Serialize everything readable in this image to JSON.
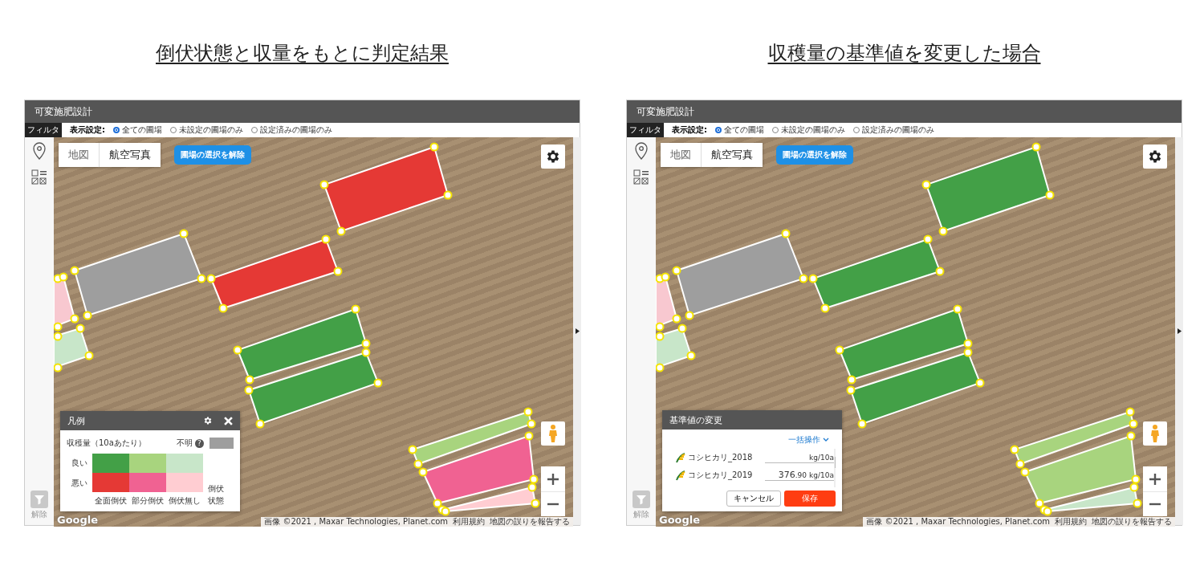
{
  "panels": [
    {
      "heading": "倒伏状態と収量をもとに判定結果",
      "app_title": "可変施肥設計",
      "filter_tab": "フィルタ",
      "display_label": "表示設定:",
      "display_options": [
        {
          "label": "全ての圃場",
          "selected": true
        },
        {
          "label": "未設定の圃場のみ",
          "selected": false
        },
        {
          "label": "設定済みの圃場のみ",
          "selected": false
        }
      ],
      "map_types": [
        {
          "label": "地図",
          "selected": false
        },
        {
          "label": "航空写真",
          "selected": true
        }
      ],
      "clear_button": "圃場の選択を解除",
      "filter_clear": "解除",
      "logo": "Google",
      "attribution": [
        "画像 ©2021 , Maxar Technologies, Planet.com",
        "利用規約",
        "地図の誤りを報告する"
      ],
      "fields": [
        {
          "color": "#e53935"
        },
        {
          "color": "#9e9e9e"
        },
        {
          "color": "#e53935"
        },
        {
          "color": "#43a047"
        },
        {
          "color": "#43a047"
        },
        {
          "color": "#f8c8d0"
        },
        {
          "color": "#c8e6c9"
        },
        {
          "color": "#a8d47e"
        },
        {
          "color": "#f06292"
        },
        {
          "color": "#ffcdd2"
        }
      ],
      "overlay": {
        "kind": "legend",
        "title": "凡例",
        "yield_label": "収穫量",
        "unit": "（10aあたり）",
        "unknown_label": "不明",
        "help_mark": "?",
        "row_labels": [
          "良い",
          "悪い"
        ],
        "grid": [
          [
            {
              "color": "#43a047"
            },
            {
              "color": "#a8d47e"
            },
            {
              "color": "#c8e6c9"
            }
          ],
          [
            {
              "color": "#e53935"
            },
            {
              "color": "#f06292"
            },
            {
              "color": "#ffcdd2"
            }
          ]
        ],
        "column_labels": [
          "全面倒伏",
          "部分倒伏",
          "倒伏無し"
        ],
        "axis_label": "倒伏状態"
      }
    },
    {
      "heading": "収穫量の基準値を変更した場合",
      "app_title": "可変施肥設計",
      "filter_tab": "フィルタ",
      "display_label": "表示設定:",
      "display_options": [
        {
          "label": "全ての圃場",
          "selected": true
        },
        {
          "label": "未設定の圃場のみ",
          "selected": false
        },
        {
          "label": "設定済みの圃場のみ",
          "selected": false
        }
      ],
      "map_types": [
        {
          "label": "地図",
          "selected": false
        },
        {
          "label": "航空写真",
          "selected": true
        }
      ],
      "clear_button": "圃場の選択を解除",
      "filter_clear": "解除",
      "logo": "Google",
      "attribution": [
        "画像 ©2021 , Maxar Technologies, Planet.com",
        "利用規約",
        "地図の誤りを報告する"
      ],
      "fields": [
        {
          "color": "#43a047"
        },
        {
          "color": "#9e9e9e"
        },
        {
          "color": "#43a047"
        },
        {
          "color": "#43a047"
        },
        {
          "color": "#43a047"
        },
        {
          "color": "#f8c8d0"
        },
        {
          "color": "#c8e6c9"
        },
        {
          "color": "#a8d47e"
        },
        {
          "color": "#a8d47e"
        },
        {
          "color": "#c8e6c9"
        }
      ],
      "overlay": {
        "kind": "baseline_editor",
        "title": "基準値の変更",
        "bulk_action": "一括操作",
        "items": [
          {
            "name": "コシヒカリ_2018",
            "unit": "kg/10a"
          },
          {
            "name": "コシヒカリ_2019",
            "value": "376",
            "value_fraction": ".90",
            "unit": "kg/10a"
          }
        ],
        "cancel_button": "キャンセル",
        "save_button": "保存"
      }
    }
  ]
}
